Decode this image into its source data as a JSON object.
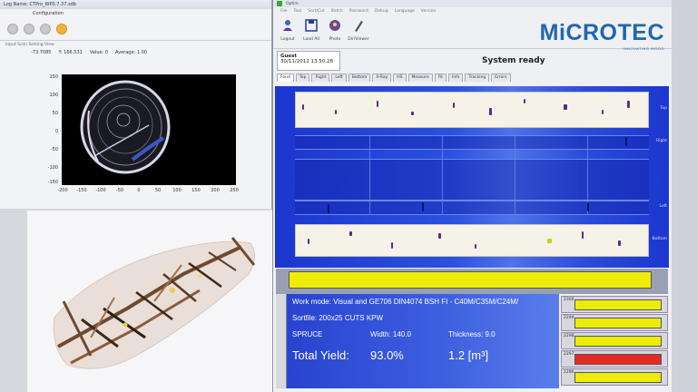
{
  "left_window": {
    "title": "Log Name: CTPro_WP0.7.37.sdb",
    "menu_label": "Configuration",
    "submenu": "Input   Scan   Setting   View",
    "stats": {
      "a": "-73.7085",
      "b": "Y: 166.531",
      "c": "Value: 0",
      "d": "Average: 1.00"
    },
    "plot": {
      "y_ticks": [
        "150",
        "100",
        "50",
        "0",
        "-50",
        "-100",
        "-150"
      ],
      "x_ticks": [
        "-200",
        "-150",
        "-100",
        "-50",
        "0",
        "50",
        "100",
        "150",
        "200",
        "250"
      ]
    },
    "toolbar_icons": [
      "open-icon",
      "save-icon",
      "print-icon",
      "run-icon"
    ]
  },
  "right_window": {
    "title": "Optim",
    "menu": [
      "File",
      "Tool",
      "Sort/Cut",
      "Batch",
      "Password",
      "Debug",
      "Language",
      "Version"
    ],
    "toolbar": [
      {
        "label": "Logout",
        "icon": "user-icon"
      },
      {
        "label": "Load All",
        "icon": "disk-icon"
      },
      {
        "label": "Photo",
        "icon": "photo-icon"
      },
      {
        "label": "Dir/Viewer",
        "icon": "pen-icon"
      }
    ],
    "brand": "MiCROTEC",
    "brand_tagline": "INNOVATING WOOD",
    "user": "Guest",
    "datetime": "30/11/2012 13.50.28",
    "status": "System ready",
    "tabs": [
      "Fond",
      "Top",
      "Right",
      "Left",
      "Bottom",
      "X-Ray",
      "HS",
      "Measure",
      "Fit",
      "Info",
      "Tracking",
      "Errors"
    ],
    "active_tab": "Fond",
    "tracks": [
      {
        "label": "Top",
        "type": "white"
      },
      {
        "label": "Right",
        "type": "blue"
      },
      {
        "label": "Left",
        "type": "blue"
      },
      {
        "label": "Bottom",
        "type": "white"
      }
    ],
    "info": {
      "work_mode": "Work mode: Visual and GE706 DIN4074 BSH FI - C40M/C35M/C24M/",
      "sortfile": "Sortfile: 200x25 CUTS KPW",
      "species": "SPRUCE",
      "width": "Width: 140.0",
      "thickness": "Thickness: 9.0",
      "total_yield_label": "Total Yield:",
      "total_yield_value": "93.0%",
      "volume": "1.2 [m³]"
    },
    "side_bars": [
      {
        "num": "2300",
        "color": "#ecec08"
      },
      {
        "num": "2299",
        "color": "#ecec08"
      },
      {
        "num": "2298",
        "color": "#ecec08"
      },
      {
        "num": "2297",
        "color": "#e42a22"
      },
      {
        "num": "2296",
        "color": "#ecec08"
      }
    ],
    "colors": {
      "scan_blue": "#2b51dd",
      "yellow_bar": "#ecec08",
      "red_bar": "#e42a22",
      "brand_blue": "#1f67ac"
    }
  }
}
